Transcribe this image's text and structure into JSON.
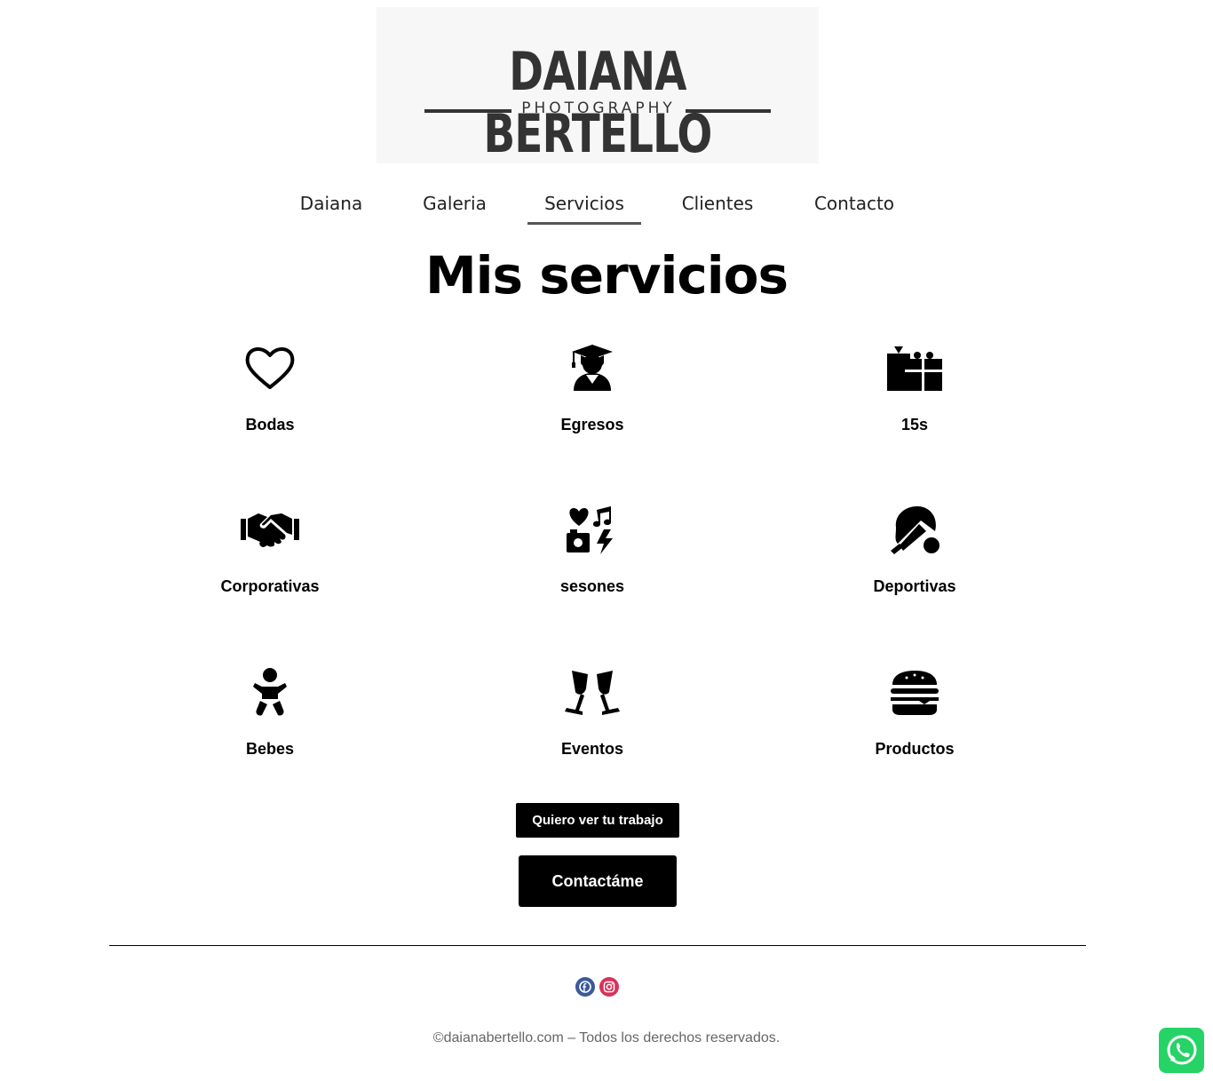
{
  "logo": {
    "title": "DAIANA BERTELLO",
    "subtitle": "PHOTOGRAPHY"
  },
  "nav": {
    "items": [
      {
        "label": "Daiana",
        "active": false
      },
      {
        "label": "Galeria",
        "active": false
      },
      {
        "label": "Servicios",
        "active": true
      },
      {
        "label": "Clientes",
        "active": false
      },
      {
        "label": "Contacto",
        "active": false
      }
    ]
  },
  "main": {
    "title": "Mis servicios",
    "services": [
      {
        "label": "Bodas",
        "icon": "heart-icon"
      },
      {
        "label": "Egresos",
        "icon": "graduate-icon"
      },
      {
        "label": "15s",
        "icon": "gifts-icon"
      },
      {
        "label": "Corporativas",
        "icon": "handshake-icon"
      },
      {
        "label": "sesones",
        "icon": "icons-collage-icon"
      },
      {
        "label": "Deportivas",
        "icon": "table-tennis-icon"
      },
      {
        "label": "Bebes",
        "icon": "baby-icon"
      },
      {
        "label": "Eventos",
        "icon": "glass-cheers-icon"
      },
      {
        "label": "Productos",
        "icon": "hamburger-icon"
      }
    ],
    "button_work": "Quiero ver tu trabajo",
    "button_contact": "Contactáme"
  },
  "footer": {
    "social": [
      {
        "name": "facebook-icon",
        "color": "#3b5998"
      },
      {
        "name": "instagram-icon",
        "color": "#d6335b"
      }
    ],
    "copyright": "©daianabertello.com – Todos los derechos reservados."
  },
  "whatsapp": {
    "icon": "whatsapp-icon",
    "color": "#25d366"
  }
}
